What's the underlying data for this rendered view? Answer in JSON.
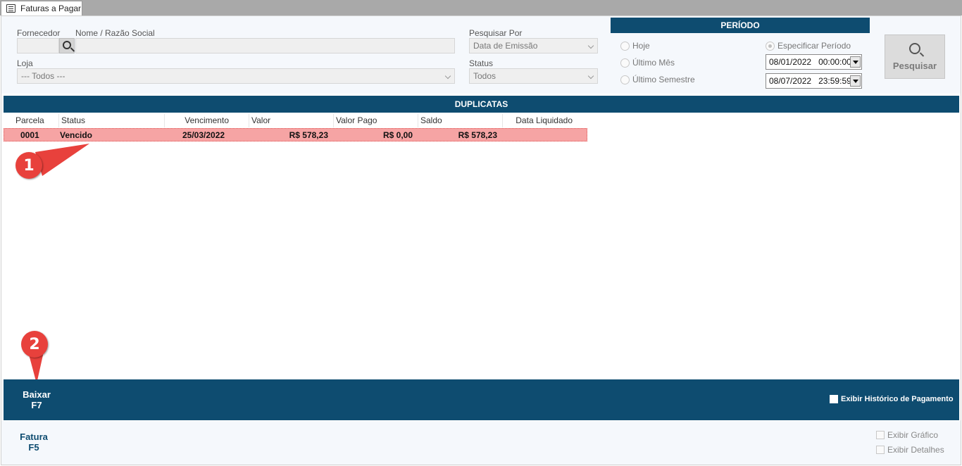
{
  "tab": {
    "label": "Faturas a Pagar"
  },
  "filters": {
    "fornecedor_label": "Fornecedor",
    "nome_label": "Nome / Razão Social",
    "loja_label": "Loja",
    "loja_value": "--- Todos ---",
    "pesquisar_por_label": "Pesquisar Por",
    "pesquisar_por_value": "Data de Emissão",
    "status_label": "Status",
    "status_value": "Todos"
  },
  "periodo": {
    "title": "PERÍODO",
    "options": [
      "Hoje",
      "Último Mês",
      "Último Semestre",
      "Especificar Período"
    ],
    "selected": "Especificar Período",
    "start_date": "08/01/2022",
    "start_time": "00:00:00",
    "end_date": "08/07/2022",
    "end_time": "23:59:59"
  },
  "search_button": {
    "label": "Pesquisar"
  },
  "duplicatas": {
    "title": "DUPLICATAS",
    "columns": [
      "Parcela",
      "Status",
      "Vencimento",
      "Valor",
      "Valor Pago",
      "Saldo",
      "Data Liquidado"
    ],
    "rows": [
      {
        "parcela": "0001",
        "status": "Vencido",
        "vencimento": "25/03/2022",
        "valor": "R$ 578,23",
        "valor_pago": "R$ 0,00",
        "saldo": "R$ 578,23",
        "data_liquidado": ""
      }
    ],
    "row_color": "#f6a4a4"
  },
  "actions": {
    "baixar_label": "Baixar",
    "baixar_key": "F7",
    "fatura_label": "Fatura",
    "fatura_key": "F5",
    "historico_label": "Exibir Histórico de Pagamento",
    "grafico_label": "Exibir Gráfico",
    "detalhes_label": "Exibir Detalhes"
  },
  "annotations": {
    "badge1": "1",
    "badge2": "2",
    "color": "#e8413c"
  },
  "colors": {
    "header_bar": "#0e4c70"
  }
}
